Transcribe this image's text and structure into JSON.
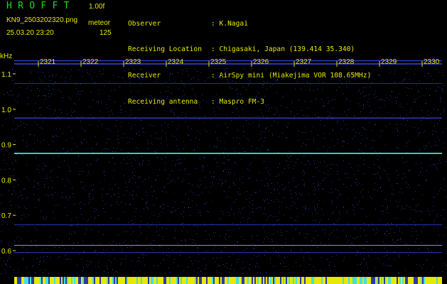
{
  "header": {
    "app_title": "HROFFT",
    "version": "1.00f",
    "filename": "KN9_2503202320.png",
    "mode": "meteor",
    "datetime": "25.03.20 23:20",
    "count": "125"
  },
  "info": [
    {
      "label": "Observer",
      "value": ": K.Nagai"
    },
    {
      "label": "Receiving Location",
      "value": ": Chigasaki, Japan (139.414 35.340)"
    },
    {
      "label": "Receiver",
      "value": ": AirSpy mini (Miakejima VOR 108.65MHz)"
    },
    {
      "label": "Receiving antenna",
      "value": ": Maspro FM-3"
    }
  ],
  "axis": {
    "unit": "kHz",
    "y_ticks": [
      "1.1",
      "1.0",
      "0.9",
      "0.8",
      "0.7",
      "0.6"
    ],
    "minute_labels": [
      "2321",
      "2322",
      "2323",
      "2324",
      "2325",
      "2326",
      "2327",
      "2328",
      "2329",
      "2330"
    ]
  },
  "colors": {
    "background": "#000000",
    "text": "#e8e800",
    "title": "#18e018",
    "signal": "#40ffd0",
    "noise": "#2a3aa0"
  }
}
